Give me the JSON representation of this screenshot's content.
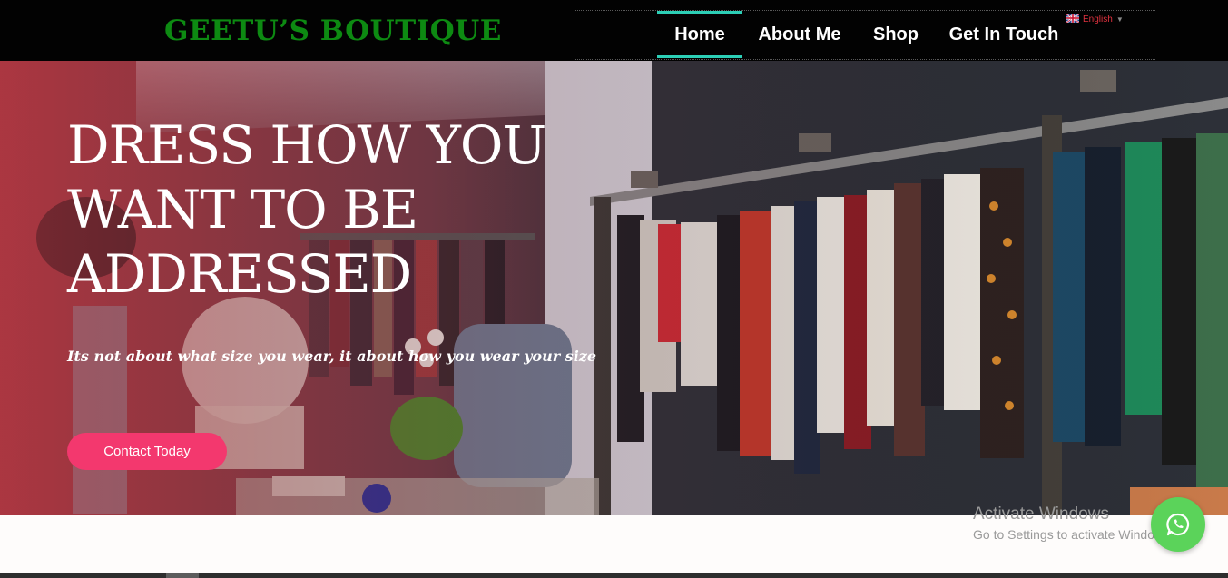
{
  "header": {
    "logo": "GEETU’S BOUTIQUE",
    "nav": [
      {
        "label": "Home",
        "active": true
      },
      {
        "label": "About Me",
        "active": false
      },
      {
        "label": "Shop",
        "active": false
      },
      {
        "label": "Get In Touch",
        "active": false
      }
    ],
    "language": {
      "label": "English",
      "flag": "uk-flag-icon"
    }
  },
  "hero": {
    "title": "DRESS HOW YOU WANT TO BE ADDRESSED",
    "subtitle": "Its not about what size you wear, it about how you wear your size",
    "cta_label": "Contact Today"
  },
  "watermark": {
    "title": "Activate Windows",
    "subtitle": "Go to Settings to activate Windows."
  },
  "floating_button": {
    "icon": "whatsapp-icon"
  },
  "colors": {
    "brand_green": "#0d8a12",
    "nav_accent": "#2ccfb6",
    "cta_pink": "#f3386e",
    "whatsapp_green": "#5bd35a"
  }
}
